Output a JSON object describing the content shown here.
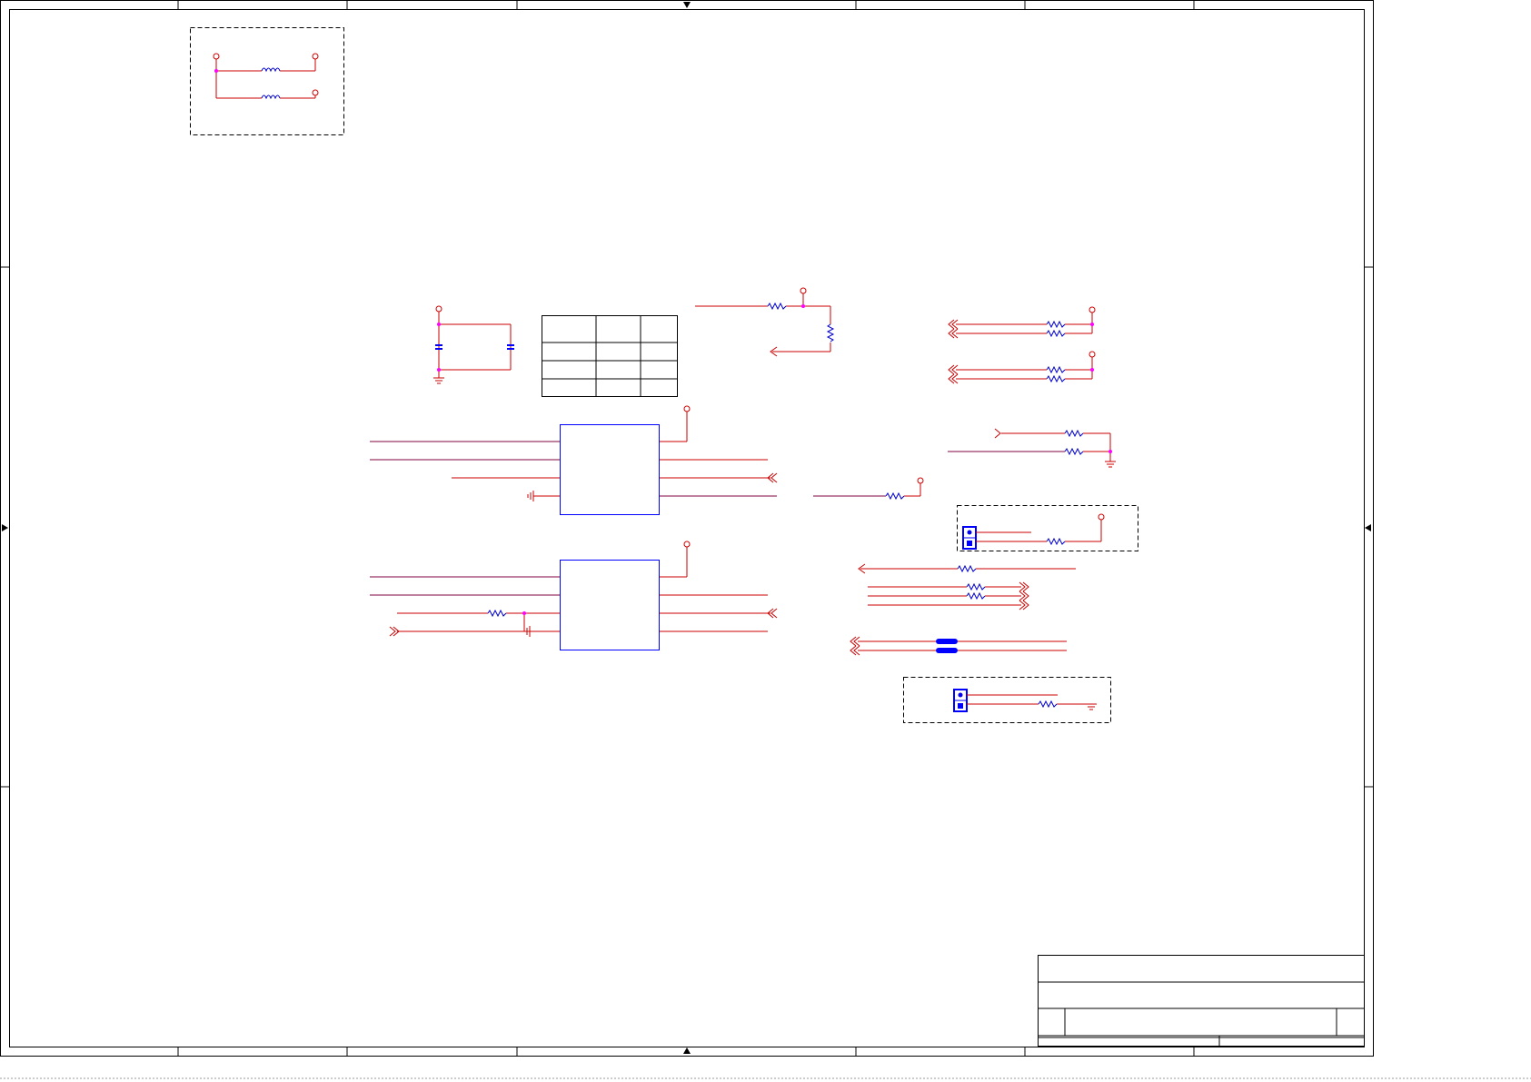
{
  "sheet": {
    "title_block": {
      "title": "",
      "size": "",
      "document_number": "",
      "rev": "",
      "date": "",
      "sheet": ""
    }
  },
  "colors": {
    "border": "#000000",
    "wire": "#cc0000",
    "net_wire": "#800040",
    "power_port": "#cc0000",
    "component_body": "#0000ff",
    "resistor": "#0000cc",
    "junction": "#ff00ff",
    "dashed_group": "#000000",
    "background": "#ffffff"
  },
  "symbols": {
    "power_port": "open-circle-power-icon",
    "ground": "ground-icon",
    "resistor": "resistor-icon",
    "inductor": "inductor-icon",
    "capacitor": "capacitor-icon",
    "jumper": "jumper-header-icon",
    "ferrite_bead": "ferrite-bead-icon",
    "port_arrow": "port-arrow-icon",
    "junction": "junction-dot-icon"
  }
}
